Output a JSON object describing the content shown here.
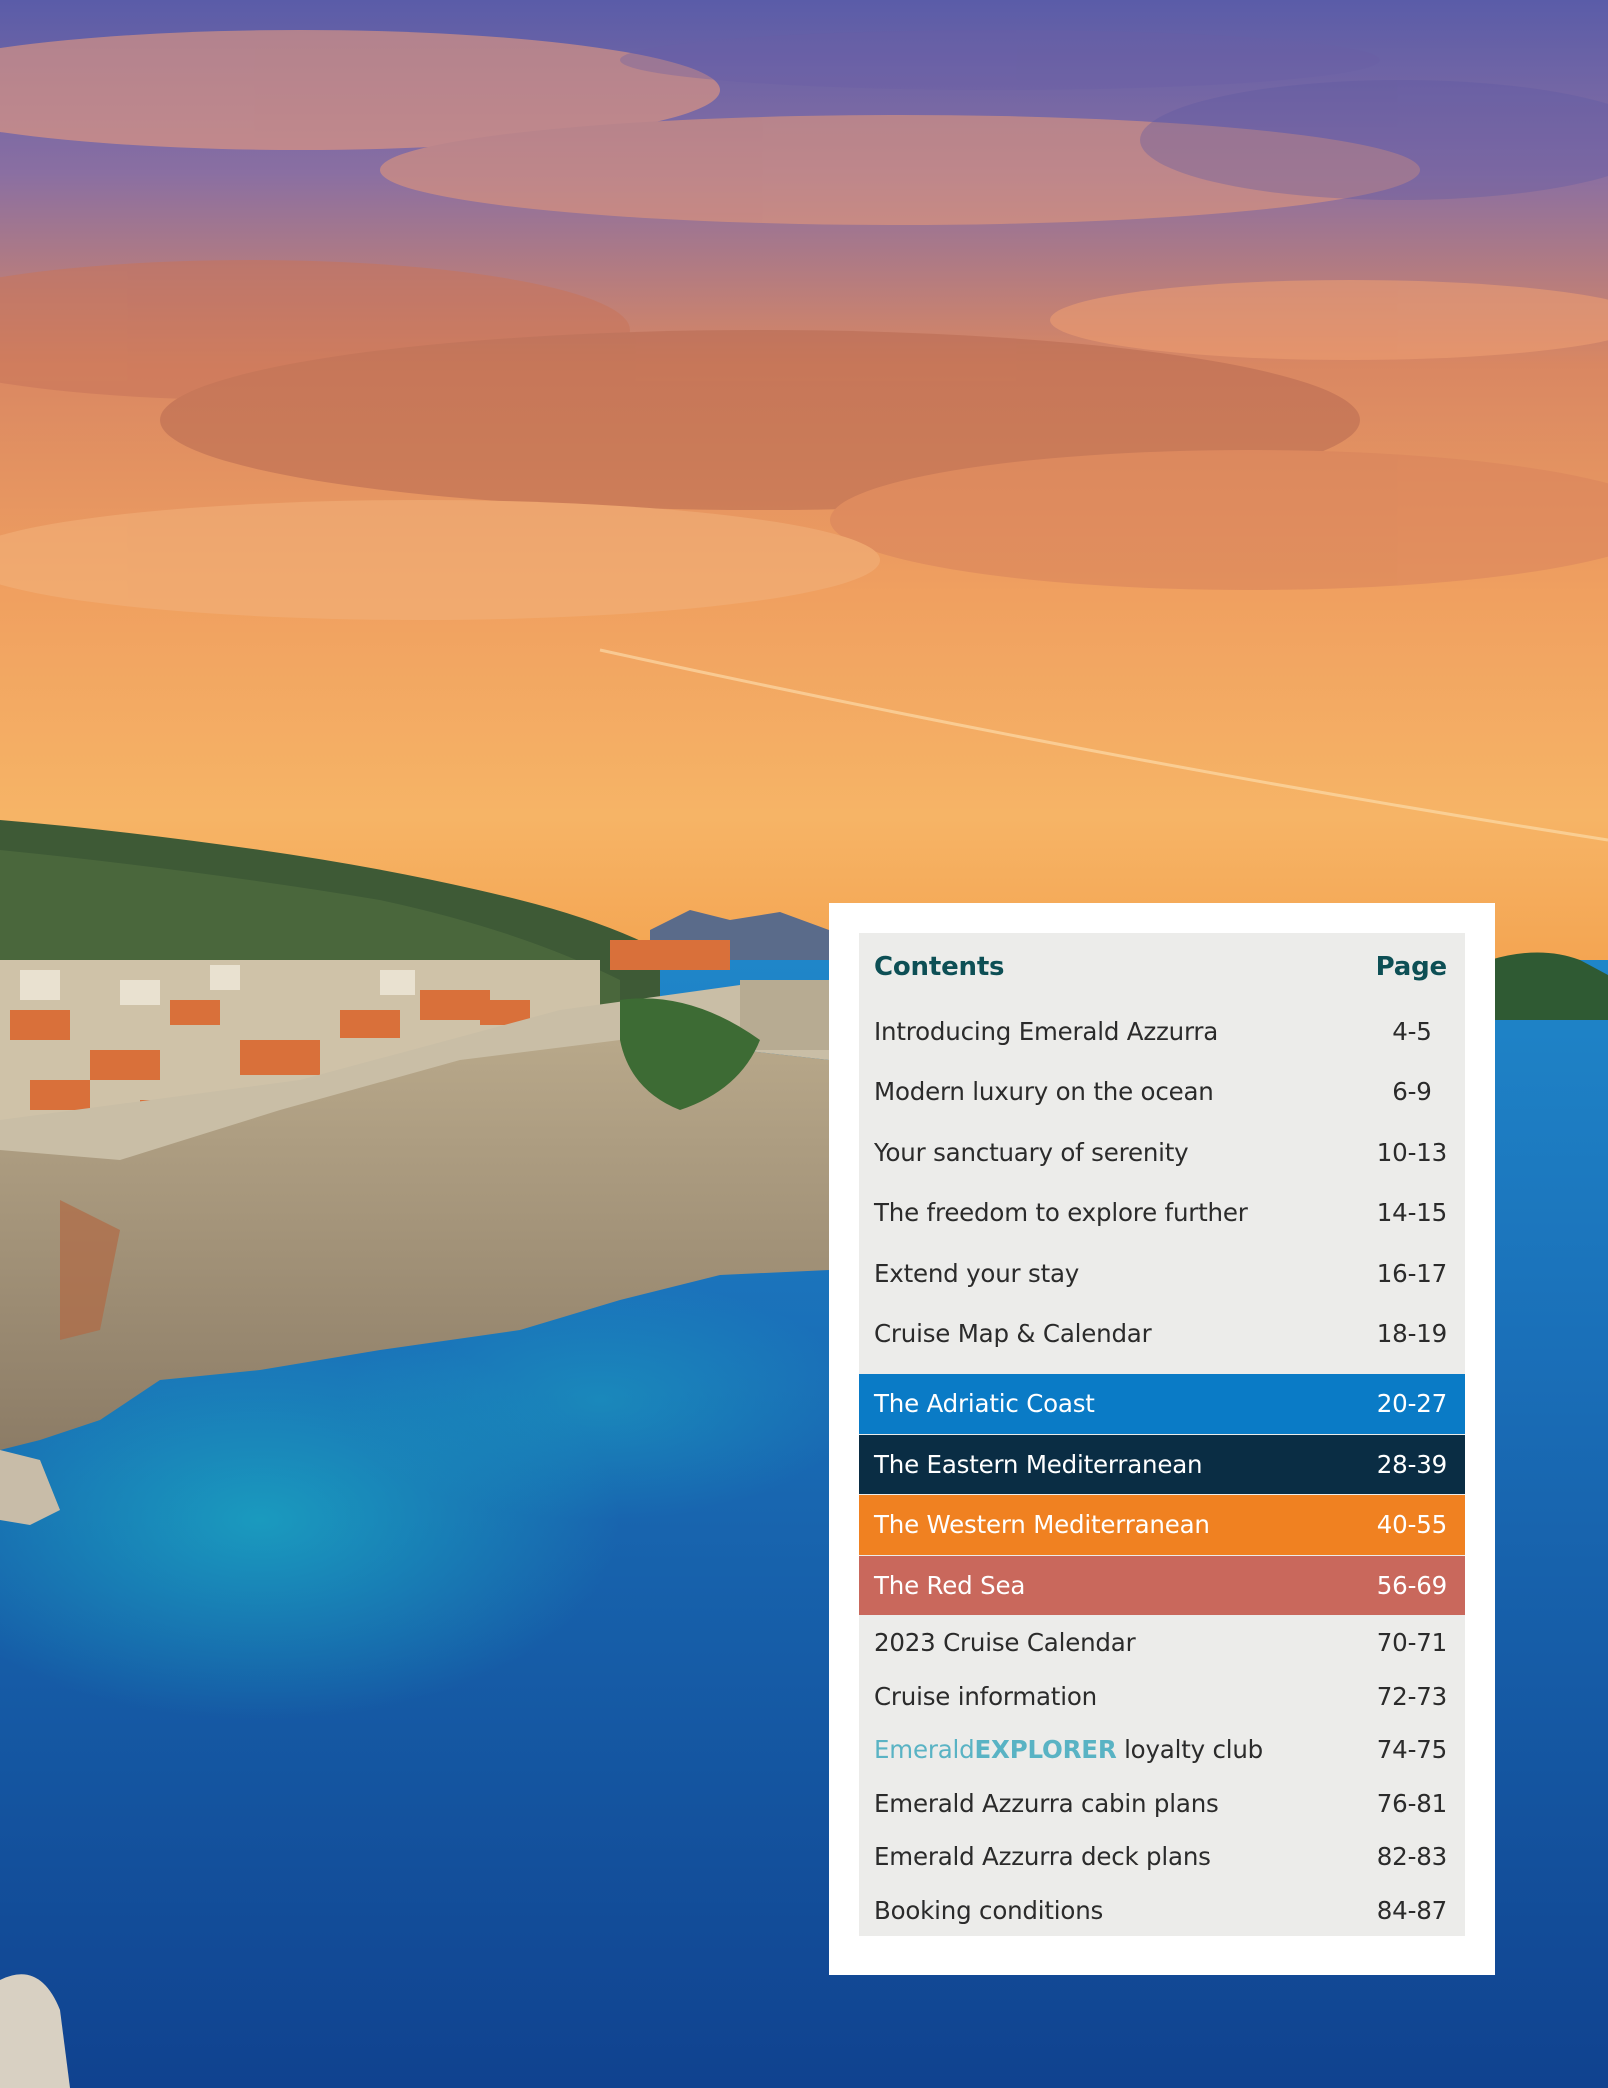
{
  "contents": {
    "heading": "Contents",
    "page_heading": "Page",
    "intro_items": [
      {
        "title": "Introducing Emerald Azzurra",
        "pages": "4-5"
      },
      {
        "title": "Modern luxury on the ocean",
        "pages": "6-9"
      },
      {
        "title": "Your sanctuary of serenity",
        "pages": "10-13"
      },
      {
        "title": "The freedom to explore further",
        "pages": "14-15"
      },
      {
        "title": "Extend your stay",
        "pages": "16-17"
      },
      {
        "title": "Cruise Map & Calendar",
        "pages": "18-19"
      }
    ],
    "regions": [
      {
        "title": "The Adriatic Coast",
        "pages": "20-27",
        "color": "#0a7bc6"
      },
      {
        "title": "The Eastern Mediterranean",
        "pages": "28-39",
        "color": "#0a2d44"
      },
      {
        "title": "The Western Mediterranean",
        "pages": "40-55",
        "color": "#f08121"
      },
      {
        "title": "The Red Sea",
        "pages": "56-69",
        "color": "#c9685c"
      }
    ],
    "calendar_item": {
      "title": "2023 Cruise Calendar",
      "pages": "70-71"
    },
    "info_item": {
      "title": "Cruise information",
      "pages": "72-73"
    },
    "loyalty_item": {
      "brand_prefix": "Emerald",
      "brand_name": "EXPLORER",
      "suffix": " loyalty club",
      "pages": "74-75"
    },
    "cabin_item": {
      "title": "Emerald Azzurra cabin plans",
      "pages": "76-81"
    },
    "deck_item": {
      "title": "Emerald Azzurra deck plans",
      "pages": "82-83"
    },
    "booking_item": {
      "title": "Booking conditions",
      "pages": "84-87"
    }
  },
  "colors": {
    "heading_teal": "#0d4f55",
    "brand_teal": "#59b3c4"
  }
}
